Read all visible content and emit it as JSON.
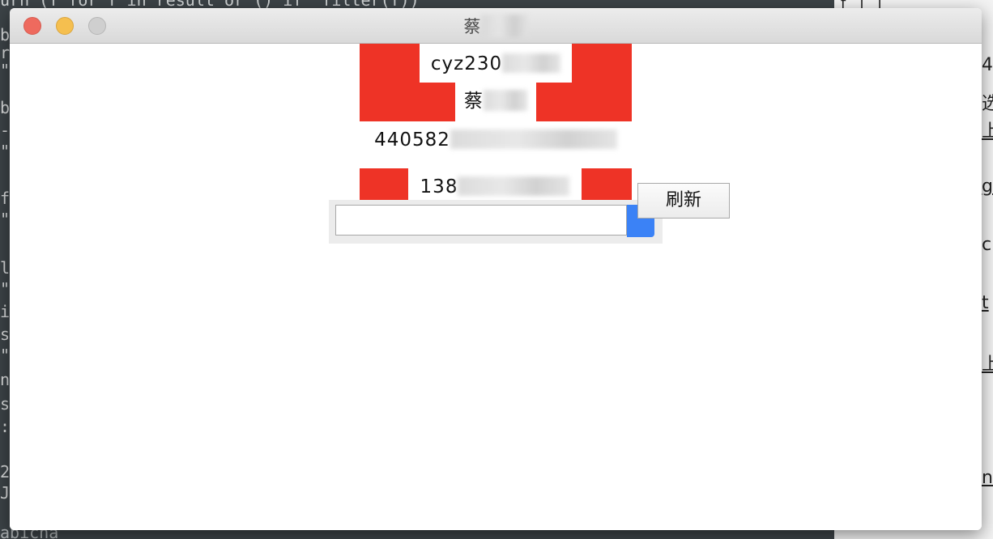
{
  "background": {
    "terminal_top_line": "urn (f for f in result or () if _filter(f))",
    "terminal_left_chars": [
      "b",
      "r",
      "\"",
      "b",
      "-",
      "\"",
      "f",
      "\"",
      "l",
      "\"",
      "i",
      "s",
      "\"",
      "n",
      "s",
      ":",
      "2",
      "J."
    ],
    "terminal_bottom_line": "abicha",
    "doc_top_line": "f   l   i",
    "doc_chars": [
      "4'",
      "选",
      "上",
      "g",
      "c",
      "t",
      "上",
      "n"
    ]
  },
  "window": {
    "title": "蔡",
    "buttons": {
      "close": "close",
      "minimize": "minimize",
      "zoom": "zoom"
    }
  },
  "fields": {
    "username": "cyz230",
    "name": "蔡",
    "id_number": "440582",
    "phone": "138"
  },
  "captcha": {
    "input_value": "",
    "input_placeholder": ""
  },
  "refresh_label": "刷新",
  "colors": {
    "red": "#ee3326",
    "blue": "#3b82f6"
  }
}
